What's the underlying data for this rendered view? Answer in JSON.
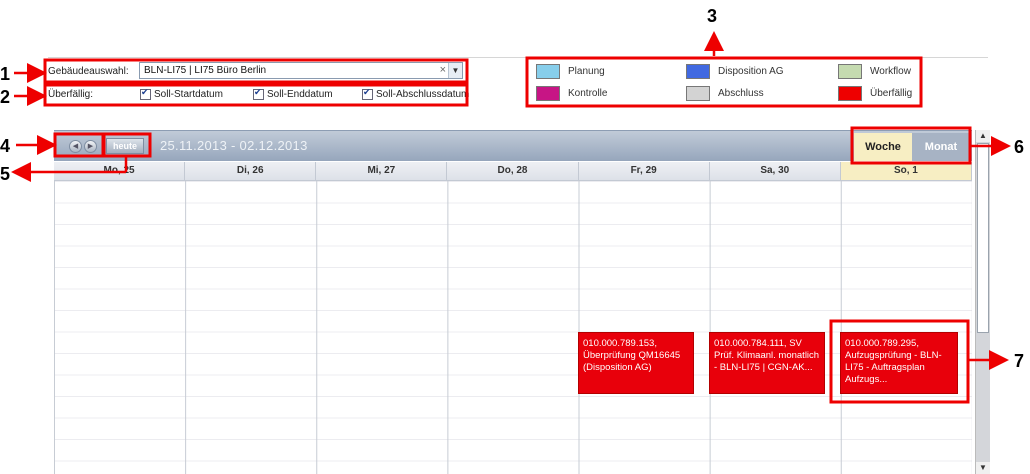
{
  "filters": {
    "building_label": "Gebäudeauswahl:",
    "building_value": "BLN-LI75 | LI75 Büro Berlin",
    "overdue_label": "Überfällig:",
    "checkboxes": [
      {
        "label": "Soll-Startdatum",
        "checked": true
      },
      {
        "label": "Soll-Enddatum",
        "checked": true
      },
      {
        "label": "Soll-Abschlussdatum",
        "checked": true
      }
    ]
  },
  "legend": [
    {
      "label": "Planung",
      "color": "#87ceeb"
    },
    {
      "label": "Disposition AG",
      "color": "#4169e1"
    },
    {
      "label": "Workflow",
      "color": "#c5dbb0"
    },
    {
      "label": "Kontrolle",
      "color": "#c71585"
    },
    {
      "label": "Abschluss",
      "color": "#d3d3d3"
    },
    {
      "label": "Überfällig",
      "color": "#ee0000"
    }
  ],
  "calendar": {
    "today_label": "heute",
    "range": "25.11.2013 - 02.12.2013",
    "views": {
      "week": "Woche",
      "month": "Monat"
    },
    "days": [
      "Mo, 25",
      "Di, 26",
      "Mi, 27",
      "Do, 28",
      "Fr, 29",
      "Sa, 30",
      "So, 1"
    ],
    "events": [
      {
        "day": "Fr, 29",
        "text": "010.000.789.153, Überprüfung QM16645 (Disposition AG)"
      },
      {
        "day": "Sa, 30",
        "text": "010.000.784.111, SV Prüf. Klimaanl. monatlich - BLN-LI75 | CGN-AK..."
      },
      {
        "day": "So, 1",
        "text": "010.000.789.295, Aufzugsprüfung - BLN-LI75 - Auftragsplan Aufzugs..."
      }
    ]
  },
  "annotations": [
    "1",
    "2",
    "3",
    "4",
    "5",
    "6",
    "7"
  ],
  "colors": {
    "annotation": "#ee0000",
    "event": "#e8000b",
    "header": "#96a6bc",
    "active_view": "#f7eec3"
  }
}
